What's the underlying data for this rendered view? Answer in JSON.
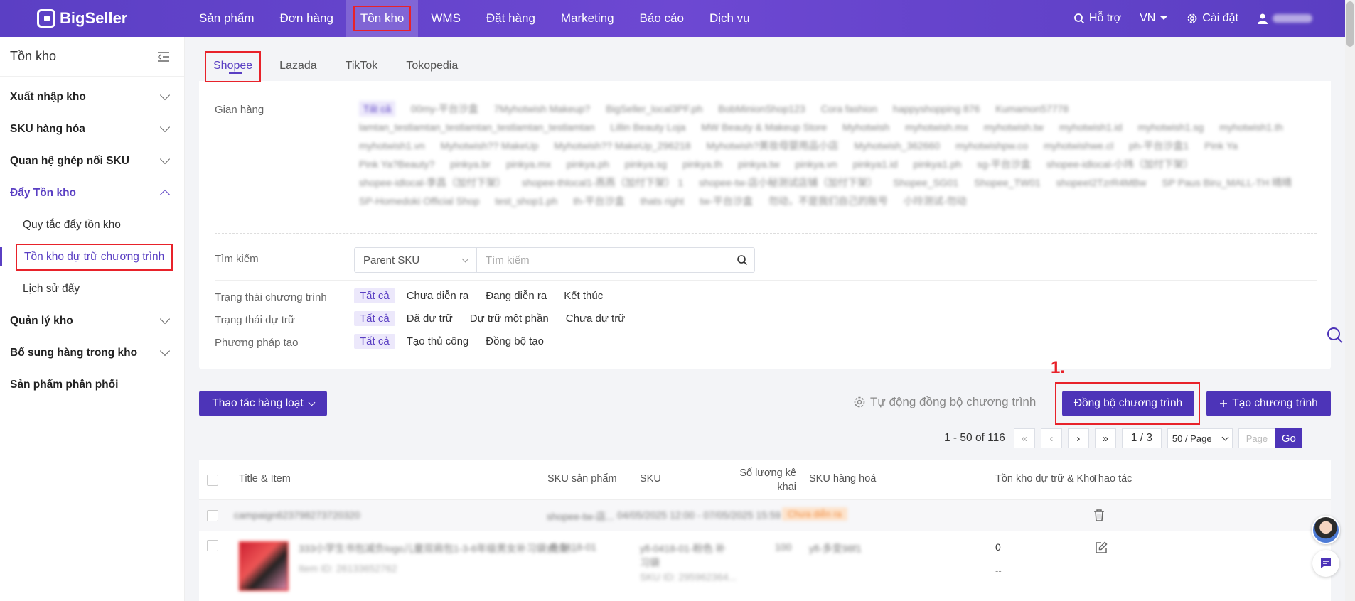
{
  "topbar": {
    "brand": "BigSeller",
    "nav": [
      "Sản phẩm",
      "Đơn hàng",
      "Tồn kho",
      "WMS",
      "Đặt hàng",
      "Marketing",
      "Báo cáo",
      "Dịch vụ"
    ],
    "active_nav": "Tồn kho",
    "support": "Hỗ trợ",
    "language": "VN",
    "settings": "Cài đặt",
    "user": "26908..."
  },
  "sidebar": {
    "title": "Tồn kho",
    "items": [
      {
        "label": "Xuất nhập kho"
      },
      {
        "label": "SKU hàng hóa"
      },
      {
        "label": "Quan hệ ghép nối SKU"
      },
      {
        "label": "Đẩy Tồn kho"
      },
      {
        "label": "Quản lý kho"
      },
      {
        "label": "Bổ sung hàng trong kho"
      },
      {
        "label": "Sản phẩm phân phối"
      }
    ],
    "sub_items": [
      "Quy tắc đẩy tồn kho",
      "Tồn kho dự trữ chương trình",
      "Lịch sử đẩy"
    ]
  },
  "tabs": [
    "Shopee",
    "Lazada",
    "TikTok",
    "Tokopedia"
  ],
  "filters": {
    "store_label": "Gian hàng",
    "stores": [
      "Tất cả",
      "00my-平台沙盒",
      "7Myhotwish Makeup?",
      "BigSeller_local3PF.ph",
      "BobMinionShop123",
      "Cora fashion",
      "happyshopping 876",
      "Kumamon57778",
      "lamtan_testlamtan_testlamtan_testlamtan_testlamtan",
      "Lillin Beauty Loja",
      "MW Beauty & Makeup Store",
      "Myhotwish",
      "myhotwish.mx",
      "myhotwish.tw",
      "myhotwish1.id",
      "myhotwish1.sg",
      "myhotwish1.th",
      "myhotwish1.vn",
      "Myhotwish?? MakeUp",
      "Myhotwish?? MakeUp_296218",
      "Myhotwish?美妆母婴用品小店",
      "Myhotwish_362660",
      "myhotwishpw.co",
      "myhotwishwe.cl",
      "ph-平台沙盒1",
      "Pink Ya",
      "Pink Ya?Beauty?",
      "pinkya.br",
      "pinkya.mx",
      "pinkya.ph",
      "pinkya.sg",
      "pinkya.th",
      "pinkya.tw",
      "pinkya.vn",
      "pinkya1.id",
      "pinkya1.ph",
      "sg-平台沙盒",
      "shopee-idlocal-小玮（加付下架）",
      "shopee-idlocal-李昌（加付下架）",
      "shopee-thlocal1-燕燕（加付下架） 1",
      "shopee-tw-店小秘测试店铺（加付下架）",
      "Shopee_SG01",
      "Shopee_TW01",
      "shopeeI2TzrR4MBw",
      "SP Paus Biru_MALL-TH 晴晴",
      "SP-Homedoki Official Shop",
      "test_shop1.ph",
      "th-平台沙盒",
      "thats right",
      "tw-平台沙盒",
      "勿动，不是我们自己的账号",
      "小玲测试-勿动"
    ],
    "search_label": "Tìm kiếm",
    "search_type": "Parent SKU",
    "search_placeholder": "Tìm kiếm",
    "program_status_label": "Trạng thái chương trình",
    "program_status": [
      "Tất cả",
      "Chưa diễn ra",
      "Đang diễn ra",
      "Kết thúc"
    ],
    "reserve_status_label": "Trạng thái dự trữ",
    "reserve_status": [
      "Tất cả",
      "Đã dự trữ",
      "Dự trữ một phần",
      "Chưa dự trữ"
    ],
    "method_label": "Phương pháp tạo",
    "method": [
      "Tất cả",
      "Tạo thủ công",
      "Đồng bộ tạo"
    ]
  },
  "actions": {
    "bulk": "Thao tác hàng loạt",
    "auto_sync": "Tự động đồng bộ chương trình",
    "step_marker": "1.",
    "sync": "Đồng bộ chương trình",
    "create": "Tạo chương trình"
  },
  "pagination": {
    "summary": "1 - 50 of 116",
    "current": "1 / 3",
    "page_size": "50 / Page",
    "page_placeholder": "Page",
    "go": "Go"
  },
  "table": {
    "headers": [
      "Title & Item",
      "SKU sản phẩm",
      "SKU",
      "Số lượng kê khai",
      "SKU hàng hoá",
      "Tồn kho dự trữ & Kho",
      "Thao tác"
    ],
    "group_row": {
      "campaign": "campaign623798273720320",
      "sku": "shopee-tw-店...",
      "time": "04/05/2025 12:00 - 07/05/2025 15:59",
      "status": "Chưa diễn ra"
    },
    "product_row": {
      "title": "333小学生书包减负logo儿童双肩包1-3-6年级男女补习袋 批发...",
      "item_id": "Item ID: 26133652762",
      "product_sku": "yfl-0418-01",
      "sku": "yfl-0418-01-粉色 补习袋",
      "sku_id": "SKU ID: 295962364...",
      "qty": "100",
      "goods_sku": "yfl-多变98f1",
      "reserve": "0",
      "warehouse": "--"
    }
  },
  "colors": {
    "primary": "#4d34b8",
    "highlight": "#e8222a",
    "topbar": "#6d48d2"
  }
}
